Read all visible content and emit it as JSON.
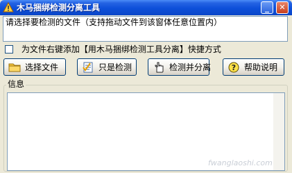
{
  "window": {
    "title": "木马捆绑检测分离工具",
    "minimize_glyph": "_",
    "close_glyph": "✕"
  },
  "path_input": {
    "value": "请选择要检测的文件（支持拖动文件到该窗体任意位置内）"
  },
  "context_menu_option": {
    "label": "为文件右键添加【用木马捆绑检测工具分离】快捷方式",
    "checked": false
  },
  "buttons": {
    "select_file": {
      "label": "选择文件",
      "icon": "folder-icon"
    },
    "check_only": {
      "label": "只是检测",
      "icon": "checklist-icon"
    },
    "check_and_separate": {
      "label": "检测并分离",
      "icon": "hand-pointer-icon"
    },
    "help": {
      "label": "帮助说明",
      "icon": "help-icon"
    }
  },
  "info_panel": {
    "legend": "信息",
    "content": ""
  },
  "watermark": {
    "text": "fwanglaoshi.com"
  },
  "colors": {
    "titlebar": "#0A46C8",
    "dialog_bg": "#ECE9D8",
    "border_blue": "#7F9DB9",
    "close_red": "#C8401F"
  }
}
